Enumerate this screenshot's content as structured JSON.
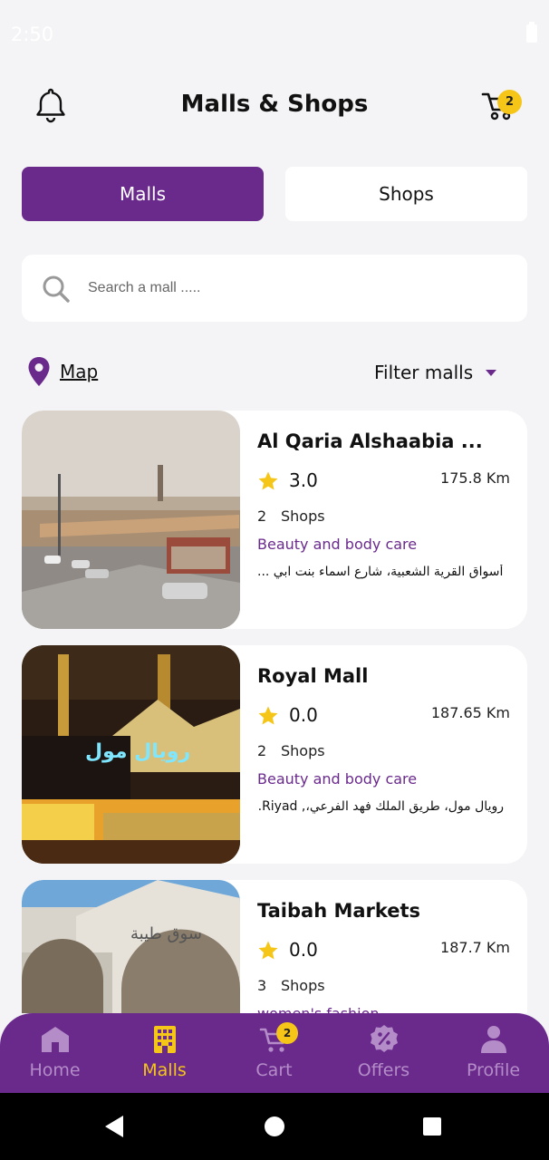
{
  "status_bar": {
    "time": "2:50"
  },
  "header": {
    "title": "Malls & Shops",
    "cart_count": "2"
  },
  "segments": {
    "malls": "Malls",
    "shops": "Shops"
  },
  "search": {
    "placeholder": "Search a mall ....."
  },
  "map": {
    "label": "Map"
  },
  "filter": {
    "label": "Filter malls"
  },
  "colors": {
    "primary": "#6a2a8c",
    "accent": "#f5c518",
    "background": "#f4f4f6"
  },
  "malls": [
    {
      "name": "Al Qaria Alshaabia ...",
      "rating": "3.0",
      "distance": "175.8 Km",
      "shop_count": "2",
      "shops_label": "Shops",
      "category": "Beauty and body care",
      "address": "أسواق القرية الشعبية، شارع اسماء بنت ابي ..."
    },
    {
      "name": "Royal Mall",
      "rating": "0.0",
      "distance": "187.65 Km",
      "shop_count": "2",
      "shops_label": "Shops",
      "category": "Beauty and body care",
      "address": "رويال مول، طريق الملك فهد الفرعي،, Riyad..."
    },
    {
      "name": "Taibah Markets",
      "rating": "0.0",
      "distance": "187.7 Km",
      "shop_count": "3",
      "shops_label": "Shops",
      "category": "women's fashion",
      "address": ""
    }
  ],
  "bottom_nav": {
    "items": [
      {
        "label": "Home",
        "icon": "home-icon"
      },
      {
        "label": "Malls",
        "icon": "building-icon"
      },
      {
        "label": "Cart",
        "icon": "cart-icon",
        "badge": "2"
      },
      {
        "label": "Offers",
        "icon": "discount-badge-icon"
      },
      {
        "label": "Profile",
        "icon": "person-icon"
      }
    ],
    "active": "Malls"
  }
}
